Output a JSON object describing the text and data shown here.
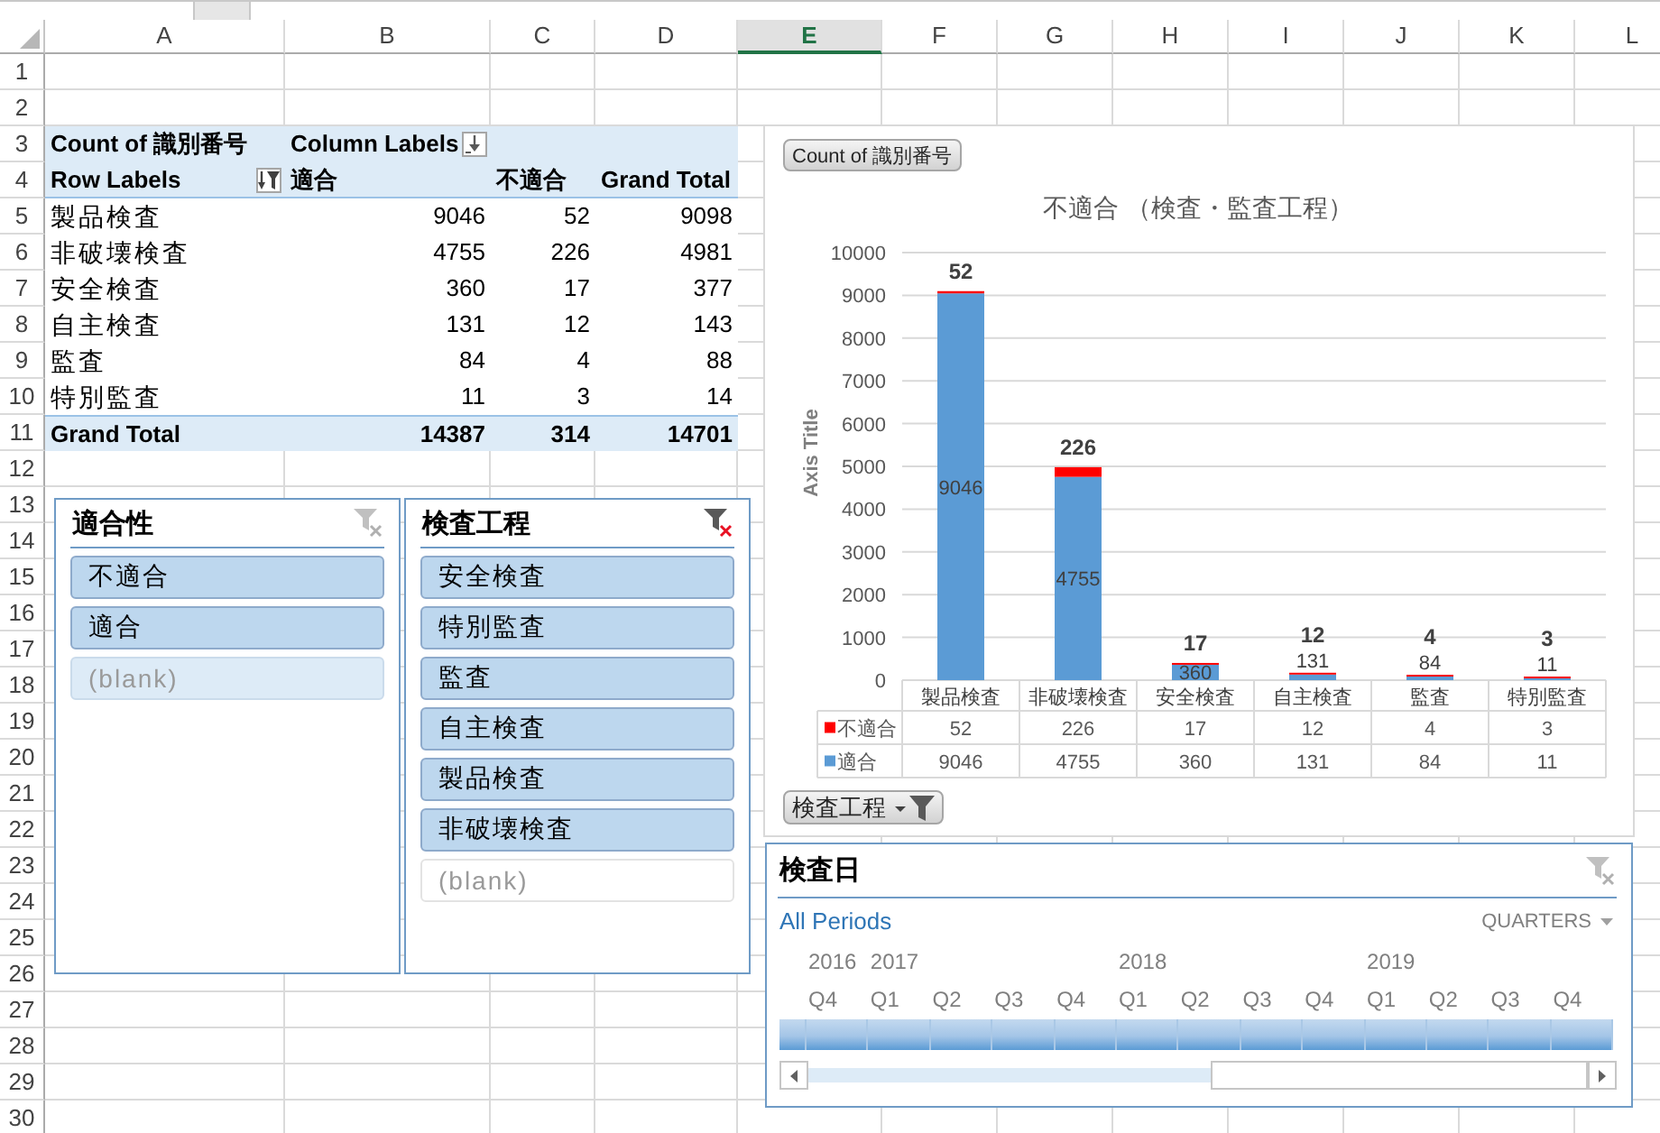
{
  "sheet": {
    "columns": [
      {
        "label": "A",
        "selected": false
      },
      {
        "label": "B",
        "selected": false
      },
      {
        "label": "C",
        "selected": false
      },
      {
        "label": "D",
        "selected": false
      },
      {
        "label": "E",
        "selected": true
      },
      {
        "label": "F",
        "selected": false
      },
      {
        "label": "G",
        "selected": false
      },
      {
        "label": "H",
        "selected": false
      },
      {
        "label": "I",
        "selected": false
      },
      {
        "label": "J",
        "selected": false
      },
      {
        "label": "K",
        "selected": false
      },
      {
        "label": "L",
        "selected": false
      }
    ],
    "rows": [
      "1",
      "2",
      "3",
      "4",
      "5",
      "6",
      "7",
      "8",
      "9",
      "10",
      "11",
      "12",
      "13",
      "14",
      "15",
      "16",
      "17",
      "18",
      "19",
      "20",
      "21",
      "22",
      "23",
      "24",
      "25",
      "26",
      "27",
      "28",
      "29",
      "30"
    ]
  },
  "pivot_table": {
    "value_field": "Count of 識別番号",
    "column_labels": "Column Labels",
    "row_labels": "Row Labels",
    "columns": [
      "適合",
      "不適合",
      "Grand Total"
    ],
    "rows": [
      {
        "label": "製品検査",
        "values": [
          "9046",
          "52",
          "9098"
        ]
      },
      {
        "label": "非破壊検査",
        "values": [
          "4755",
          "226",
          "4981"
        ]
      },
      {
        "label": "安全検査",
        "values": [
          "360",
          "17",
          "377"
        ]
      },
      {
        "label": "自主検査",
        "values": [
          "131",
          "12",
          "143"
        ]
      },
      {
        "label": "監査",
        "values": [
          "84",
          "4",
          "88"
        ]
      },
      {
        "label": "特別監査",
        "values": [
          "11",
          "3",
          "14"
        ]
      }
    ],
    "grand_total": {
      "label": "Grand Total",
      "values": [
        "14387",
        "314",
        "14701"
      ]
    }
  },
  "slicers": [
    {
      "title": "適合性",
      "filtered": false,
      "items": [
        {
          "label": "不適合",
          "selected": true,
          "has_data": true
        },
        {
          "label": "適合",
          "selected": true,
          "has_data": true
        },
        {
          "label": "(blank)",
          "selected": true,
          "has_data": false
        }
      ]
    },
    {
      "title": "検査工程",
      "filtered": true,
      "items": [
        {
          "label": "安全検査",
          "selected": true,
          "has_data": true
        },
        {
          "label": "特別監査",
          "selected": true,
          "has_data": true
        },
        {
          "label": "監査",
          "selected": true,
          "has_data": true
        },
        {
          "label": "自主検査",
          "selected": true,
          "has_data": true
        },
        {
          "label": "製品検査",
          "selected": true,
          "has_data": true
        },
        {
          "label": "非破壊検査",
          "selected": true,
          "has_data": true
        },
        {
          "label": "(blank)",
          "selected": false,
          "has_data": false
        }
      ]
    }
  ],
  "pivot_chart": {
    "value_button": "Count of 識別番号",
    "axis_button": "検査工程",
    "chart_data": {
      "type": "bar",
      "title": "不適合 （検査・監査工程）",
      "ylabel": "Axis Title",
      "categories": [
        "製品検査",
        "非破壊検査",
        "安全検査",
        "自主検査",
        "監査",
        "特別監査"
      ],
      "series": [
        {
          "name": "適合",
          "color": "#5b9bd5",
          "values": [
            9046,
            4755,
            360,
            131,
            84,
            11
          ]
        },
        {
          "name": "不適合",
          "color": "#ff0000",
          "values": [
            52,
            226,
            17,
            12,
            4,
            3
          ]
        }
      ],
      "ylim": [
        0,
        10000
      ],
      "yticks": [
        0,
        1000,
        2000,
        3000,
        4000,
        5000,
        6000,
        7000,
        8000,
        9000,
        10000
      ],
      "stacked": true,
      "data_labels": true,
      "value_labels": [
        [
          "9046",
          "4755",
          "360",
          "131",
          "84",
          "11"
        ],
        [
          "52",
          "226",
          "17",
          "12",
          "4",
          "3"
        ]
      ],
      "grid": true,
      "legend": "bottom"
    },
    "data_table": {
      "rows": [
        {
          "values": [
            "52",
            "226",
            "17",
            "12",
            "4",
            "3"
          ]
        },
        {
          "values": [
            "9046",
            "4755",
            "360",
            "131",
            "84",
            "11"
          ]
        }
      ]
    }
  },
  "timeline": {
    "title": "検査日",
    "filtered": false,
    "selection": "All Periods",
    "period_menu": "QUARTERS",
    "years": [
      {
        "label": "2016",
        "quarters": [
          {
            "label": "Q4",
            "selected": true
          }
        ]
      },
      {
        "label": "2017",
        "quarters": [
          {
            "label": "Q1",
            "selected": true
          },
          {
            "label": "Q2",
            "selected": true
          },
          {
            "label": "Q3",
            "selected": true
          },
          {
            "label": "Q4",
            "selected": true
          }
        ]
      },
      {
        "label": "2018",
        "quarters": [
          {
            "label": "Q1",
            "selected": true
          },
          {
            "label": "Q2",
            "selected": true
          },
          {
            "label": "Q3",
            "selected": true
          },
          {
            "label": "Q4",
            "selected": true
          }
        ]
      },
      {
        "label": "2019",
        "quarters": [
          {
            "label": "Q1",
            "selected": true
          },
          {
            "label": "Q2",
            "selected": true
          },
          {
            "label": "Q3",
            "selected": true
          },
          {
            "label": "Q4",
            "selected": true
          }
        ]
      }
    ]
  }
}
